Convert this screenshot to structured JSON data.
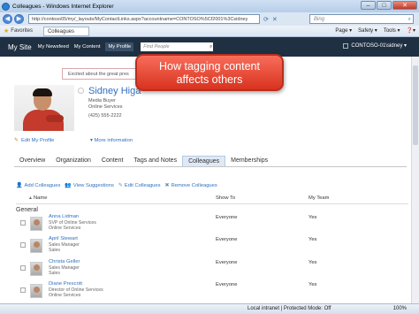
{
  "window": {
    "title": "Colleagues - Windows Internet Explorer",
    "url": "http://contoso05/my/_layouts/MyContactLinks.aspx?accountname=CONTOSO%5Cf2001%3Csidney",
    "search_placeholder": "Bing",
    "controls": {
      "minimize": "–",
      "maximize": "□",
      "close": "✕"
    }
  },
  "favorites": {
    "label": "Favorites",
    "tab_label": "Colleagues",
    "commands": [
      "Page ▾",
      "Safety ▾",
      "Tools ▾",
      "❓▾"
    ]
  },
  "sharepoint_nav": {
    "site_title": "My Site",
    "links": [
      "My Newsfeed",
      "My Content",
      "My Profile"
    ],
    "search_placeholder": "Find People",
    "user_label": "CONTOSO-01\\sidney ▾"
  },
  "profile": {
    "status_text": "Excited about the great pres",
    "name": "Sidney Higa",
    "title": "Media Buyer",
    "department": "Online Services",
    "phone": "(425) 555-2222",
    "edit_link": "Edit My Profile",
    "more_info": "More information"
  },
  "callout": {
    "line1": "How tagging content",
    "line2": "affects others"
  },
  "tabs": [
    "Overview",
    "Organization",
    "Content",
    "Tags and Notes",
    "Colleagues",
    "Memberships"
  ],
  "toolbar": {
    "add": "Add Colleagues",
    "view": "View Suggestions",
    "edit": "Edit Colleagues",
    "remove": "Remove Colleagues"
  },
  "table": {
    "headers": {
      "name": "Name",
      "show_to": "Show To",
      "team": "My Team"
    },
    "group": "General",
    "rows": [
      {
        "name": "Anna Lidman",
        "line1": "SVP of Online Services",
        "line2": "Online Services",
        "show_to": "Everyone",
        "team": "Yes"
      },
      {
        "name": "April Stewart",
        "line1": "Sales Manager",
        "line2": "Sales",
        "show_to": "Everyone",
        "team": "Yes"
      },
      {
        "name": "Christa Geller",
        "line1": "Sales Manager",
        "line2": "Sales",
        "show_to": "Everyone",
        "team": "Yes"
      },
      {
        "name": "Diane Prescott",
        "line1": "Director of Online Services",
        "line2": "Online Services",
        "show_to": "Everyone",
        "team": "Yes"
      }
    ]
  },
  "status_bar": {
    "zone": "Local intranet | Protected Mode: Off",
    "zoom": "100%"
  }
}
